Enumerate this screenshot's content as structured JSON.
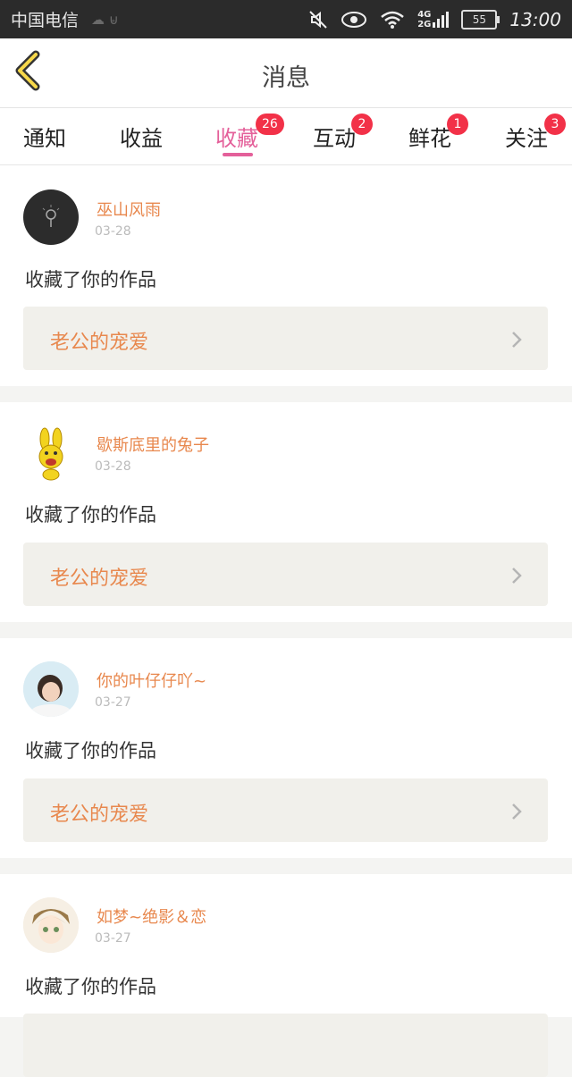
{
  "status_bar": {
    "carrier": "中国电信",
    "net_top": "4G",
    "net_bottom": "2G",
    "battery": "55",
    "time": "13:00"
  },
  "header": {
    "title": "消息",
    "back_icon": "back-chevron-icon"
  },
  "tabs": [
    {
      "label": "通知",
      "badge": ""
    },
    {
      "label": "收益",
      "badge": ""
    },
    {
      "label": "收藏",
      "badge": "26",
      "active": true
    },
    {
      "label": "互动",
      "badge": "2"
    },
    {
      "label": "鲜花",
      "badge": "1"
    },
    {
      "label": "关注",
      "badge": "3"
    }
  ],
  "messages": [
    {
      "username": "巫山风雨",
      "date": "03-28",
      "action": "收藏了你的作品",
      "work": "老公的宠爱"
    },
    {
      "username": "歇斯底里的兔子",
      "date": "03-28",
      "action": "收藏了你的作品",
      "work": "老公的宠爱"
    },
    {
      "username": "你的叶仔仔吖~",
      "date": "03-27",
      "action": "收藏了你的作品",
      "work": "老公的宠爱"
    },
    {
      "username": "如梦~绝影＆恋",
      "date": "03-27",
      "action": "收藏了你的作品",
      "work": ""
    }
  ],
  "colors": {
    "accent_pink": "#e4609a",
    "badge_red": "#f23148",
    "username_orange": "#e8884e"
  }
}
